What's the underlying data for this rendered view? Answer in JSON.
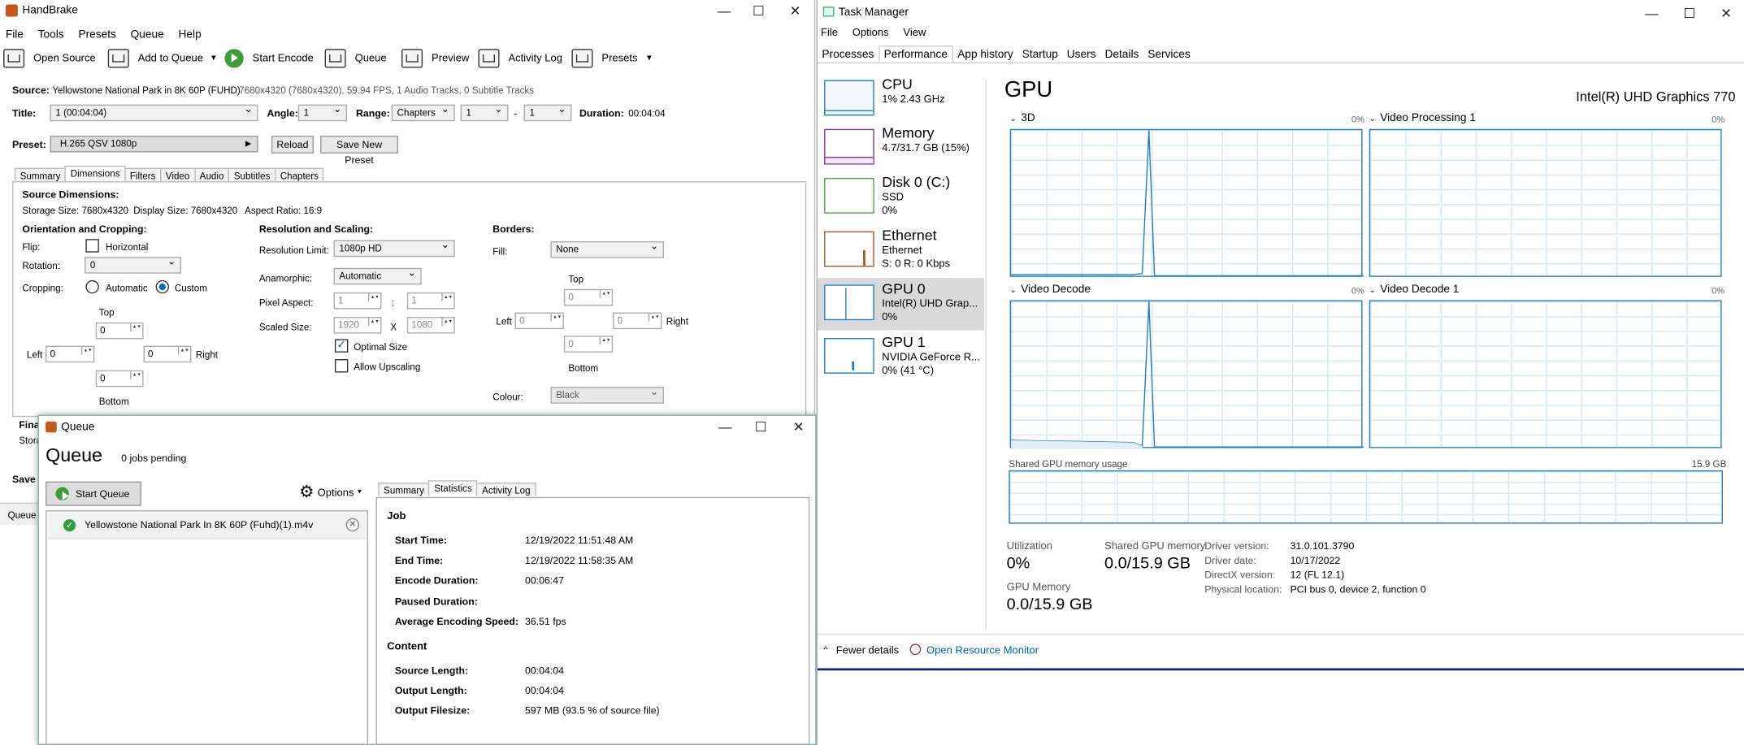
{
  "handbrake": {
    "title": "HandBrake",
    "menu": [
      "File",
      "Tools",
      "Presets",
      "Queue",
      "Help"
    ],
    "toolbar": {
      "open_source": "Open Source",
      "add_to_queue": "Add to Queue",
      "start_encode": "Start Encode",
      "queue": "Queue",
      "preview": "Preview",
      "activity_log": "Activity Log",
      "presets": "Presets"
    },
    "source_label": "Source:",
    "source_name": "Yellowstone National Park in 8K 60P (FUHD)",
    "source_info": "7680x4320 (7680x4320), 59.94 FPS, 1 Audio Tracks, 0 Subtitle Tracks",
    "title_label": "Title:",
    "title_value": "1 (00:04:04)",
    "angle_label": "Angle:",
    "angle_value": "1",
    "range_label": "Range:",
    "range_value": "Chapters",
    "range_from": "1",
    "range_dash": "-",
    "range_to": "1",
    "duration_label": "Duration:",
    "duration_value": "00:04:04",
    "preset_label": "Preset:",
    "preset_value": "H.265 QSV 1080p",
    "reload": "Reload",
    "save_new_preset": "Save New Preset",
    "tabs": [
      "Summary",
      "Dimensions",
      "Filters",
      "Video",
      "Audio",
      "Subtitles",
      "Chapters"
    ],
    "source_dimensions": "Source Dimensions:",
    "storage_size": "Storage Size: 7680x4320",
    "display_size": "Display Size: 7680x4320",
    "aspect_ratio": "Aspect Ratio: 16:9",
    "orientation": "Orientation and Cropping:",
    "flip_label": "Flip:",
    "horizontal": "Horizontal",
    "rotation_label": "Rotation:",
    "rotation_value": "0",
    "cropping_label": "Cropping:",
    "automatic": "Automatic",
    "custom": "Custom",
    "top": "Top",
    "bottom": "Bottom",
    "left": "Left",
    "right": "Right",
    "crop_top": "0",
    "crop_left": "0",
    "crop_right": "0",
    "crop_bottom": "0",
    "resolution_scaling": "Resolution and Scaling:",
    "resolution_limit_label": "Resolution Limit:",
    "resolution_limit_value": "1080p HD",
    "anamorphic_label": "Anamorphic:",
    "anamorphic_value": "Automatic",
    "pixel_aspect_label": "Pixel Aspect:",
    "pixel_aspect_w": "1",
    "colon": ":",
    "pixel_aspect_h": "1",
    "scaled_size_label": "Scaled Size:",
    "scaled_w": "1920",
    "x": "X",
    "scaled_h": "1080",
    "optimal_size": "Optimal Size",
    "allow_upscaling": "Allow Upscaling",
    "borders": "Borders:",
    "fill_label": "Fill:",
    "fill_value": "None",
    "b_top": "0",
    "b_left": "0",
    "b_right": "0",
    "b_bottom": "0",
    "colour_label": "Colour:",
    "colour_value": "Black",
    "final_partial": "Fina",
    "storage_partial": "Stora",
    "save_partial": "Save A",
    "queue_status": "Queue"
  },
  "queue": {
    "title": "Queue",
    "heading": "Queue",
    "jobs_pending": "0 jobs pending",
    "start_queue": "Start Queue",
    "options": "Options",
    "item": "Yellowstone National Park In 8K 60P (Fuhd)(1).m4v",
    "tabs": [
      "Summary",
      "Statistics",
      "Activity Log"
    ],
    "job_heading": "Job",
    "start_time_label": "Start Time:",
    "start_time": "12/19/2022 11:51:48 AM",
    "end_time_label": "End Time:",
    "end_time": "12/19/2022 11:58:35 AM",
    "encode_duration_label": "Encode Duration:",
    "encode_duration": "00:06:47",
    "paused_duration_label": "Paused Duration:",
    "avg_speed_label": "Average Encoding Speed:",
    "avg_speed": "36.51 fps",
    "content_heading": "Content",
    "source_length_label": "Source Length:",
    "source_length": "00:04:04",
    "output_length_label": "Output Length:",
    "output_length": "00:04:04",
    "output_filesize_label": "Output Filesize:",
    "output_filesize": "597 MB (93.5 % of source file)"
  },
  "taskmanager": {
    "title": "Task Manager",
    "menu": [
      "File",
      "Options",
      "View"
    ],
    "tabs": [
      "Processes",
      "Performance",
      "App history",
      "Startup",
      "Users",
      "Details",
      "Services"
    ],
    "sidebar": [
      {
        "name": "CPU",
        "sub1": "1% 2.43 GHz",
        "sub2": "",
        "color": "#1e7cc4"
      },
      {
        "name": "Memory",
        "sub1": "4.7/31.7 GB (15%)",
        "sub2": "",
        "color": "#8b2a9c"
      },
      {
        "name": "Disk 0 (C:)",
        "sub1": "SSD",
        "sub2": "0%",
        "color": "#4aa53b"
      },
      {
        "name": "Ethernet",
        "sub1": "Ethernet",
        "sub2": "S: 0 R: 0 Kbps",
        "color": "#a7581f"
      },
      {
        "name": "GPU 0",
        "sub1": "Intel(R) UHD Grap...",
        "sub2": "0%",
        "color": "#1e7cc4"
      },
      {
        "name": "GPU 1",
        "sub1": "NVIDIA GeForce R...",
        "sub2": "0% (41 °C)",
        "color": "#1e7cc4"
      }
    ],
    "gpu_title": "GPU",
    "gpu_model": "Intel(R) UHD Graphics 770",
    "graphs": [
      {
        "label": "3D",
        "pct": "0%"
      },
      {
        "label": "Video Processing 1",
        "pct": "0%"
      },
      {
        "label": "Video Decode",
        "pct": "0%"
      },
      {
        "label": "Video Decode 1",
        "pct": "0%"
      }
    ],
    "shared_label": "Shared GPU memory usage",
    "shared_max": "15.9 GB",
    "utilization_label": "Utilization",
    "utilization": "0%",
    "shared_mem_label": "Shared GPU memory",
    "shared_mem": "0.0/15.9 GB",
    "gpu_mem_label": "GPU Memory",
    "gpu_mem": "0.0/15.9 GB",
    "driver_version_label": "Driver version:",
    "driver_version": "31.0.101.3790",
    "driver_date_label": "Driver date:",
    "driver_date": "10/17/2022",
    "directx_label": "DirectX version:",
    "directx": "12 (FL 12.1)",
    "physical_label": "Physical location:",
    "physical": "PCI bus 0, device 2, function 0",
    "fewer_details": "Fewer details",
    "open_resource_monitor": "Open Resource Monitor"
  }
}
